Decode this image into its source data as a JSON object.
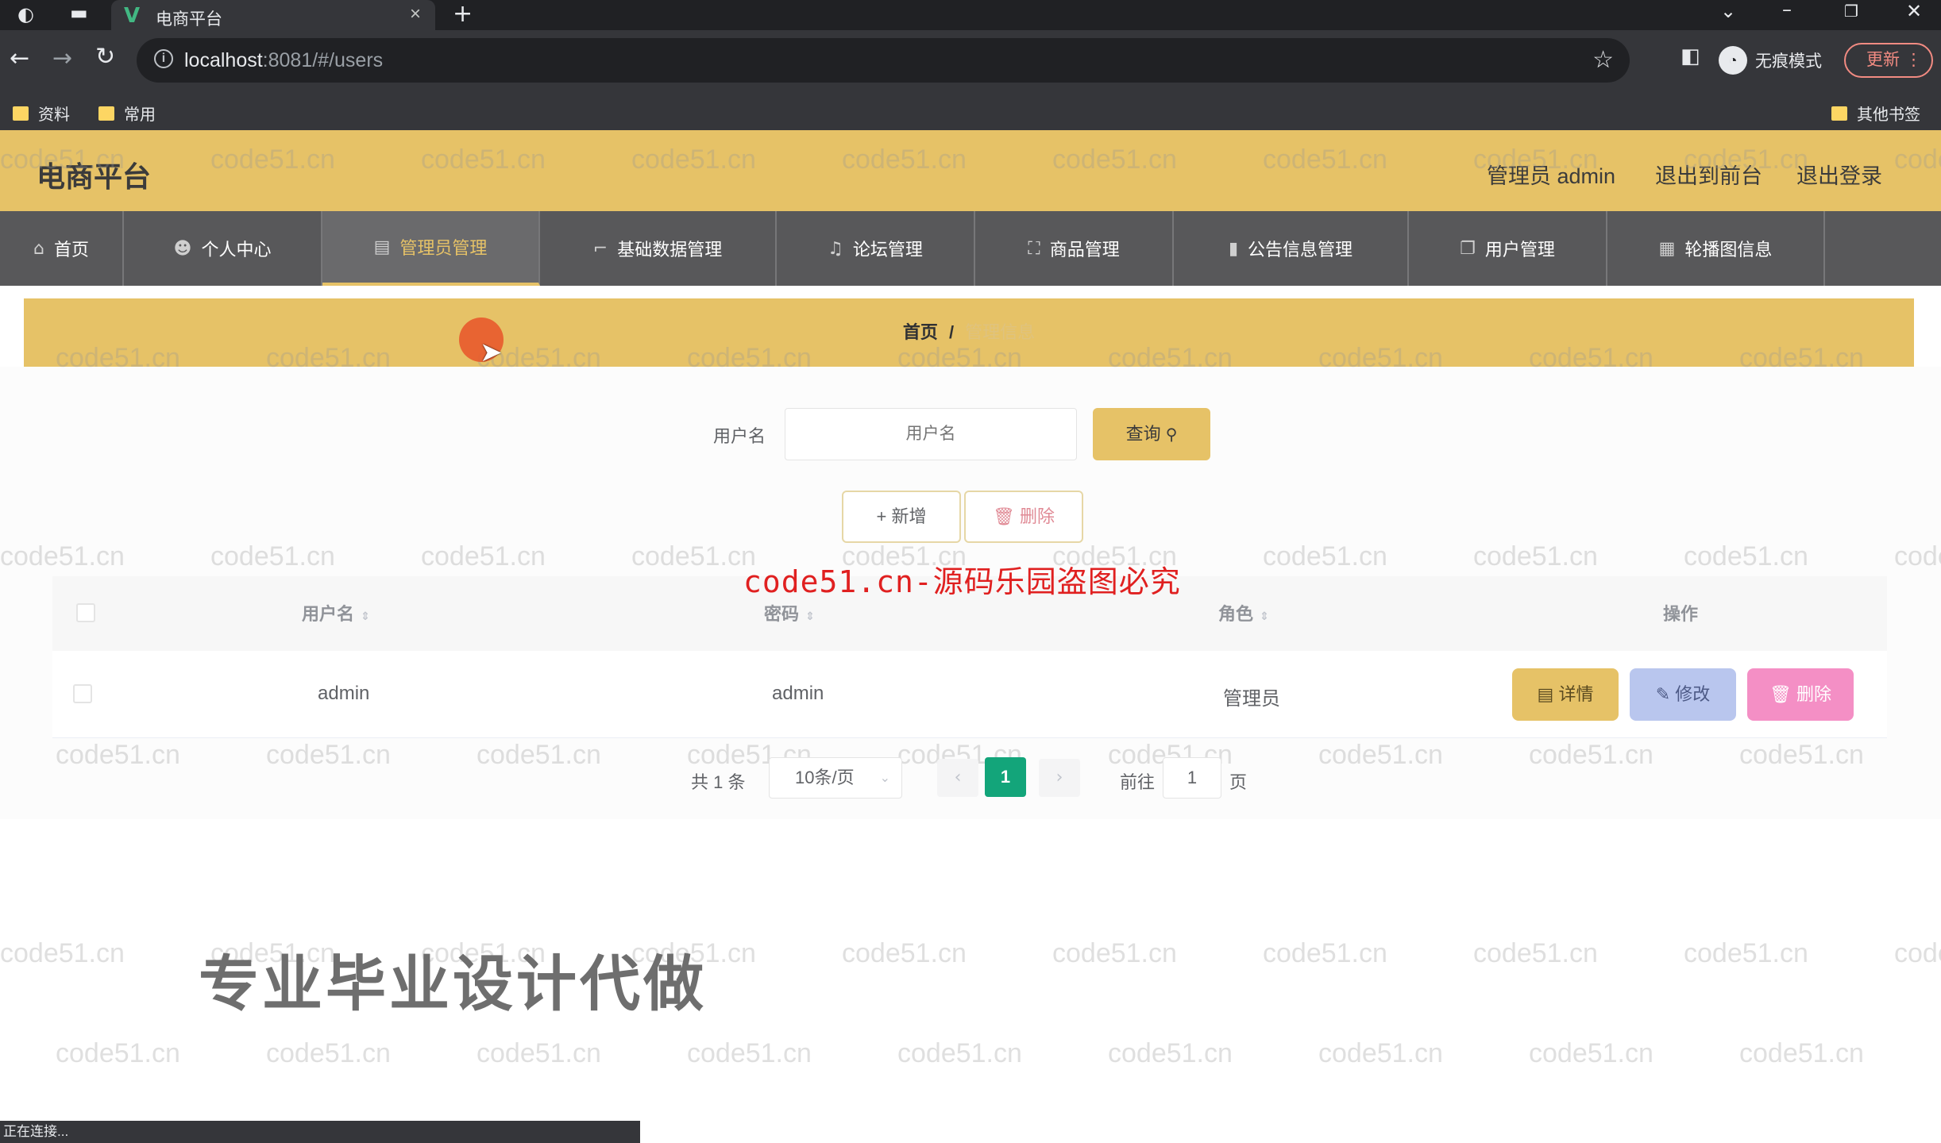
{
  "browser": {
    "tab_title": "电商平台",
    "tab_logo": "V",
    "url_host": "localhost",
    "url_rest": ":8081/#/users",
    "incognito_label": "无痕模式",
    "update_label": "更新",
    "bookmarks": [
      "资料",
      "常用"
    ],
    "other_bookmarks": "其他书签",
    "status_text": "正在连接..."
  },
  "header": {
    "title": "电商平台",
    "user_label": "管理员 admin",
    "to_front_label": "退出到前台",
    "logout_label": "退出登录"
  },
  "nav": {
    "items": [
      {
        "label": "首页",
        "icon": "home-icon"
      },
      {
        "label": "个人中心",
        "icon": "user-icon"
      },
      {
        "label": "管理员管理",
        "icon": "table-icon"
      },
      {
        "label": "基础数据管理",
        "icon": "crop-icon"
      },
      {
        "label": "论坛管理",
        "icon": "mic-icon"
      },
      {
        "label": "商品管理",
        "icon": "fullscreen-icon"
      },
      {
        "label": "公告信息管理",
        "icon": "notice-icon"
      },
      {
        "label": "用户管理",
        "icon": "copy-icon"
      },
      {
        "label": "轮播图信息",
        "icon": "grid-icon"
      }
    ]
  },
  "breadcrumb": {
    "home": "首页",
    "separator": "/",
    "current": "管理信息"
  },
  "search": {
    "label": "用户名",
    "placeholder": "用户名",
    "query_label": "查询"
  },
  "actions": {
    "add_label": "新增",
    "delete_label": "删除"
  },
  "table": {
    "headers": {
      "username": "用户名",
      "password": "密码",
      "role": "角色",
      "operation": "操作"
    },
    "rows": [
      {
        "username": "admin",
        "password": "admin",
        "role": "管理员"
      }
    ],
    "row_actions": {
      "detail": "详情",
      "edit": "修改",
      "delete": "删除"
    }
  },
  "pagination": {
    "total": "共 1 条",
    "page_size": "10条/页",
    "current_page": "1",
    "goto_label": "前往",
    "goto_value": "1",
    "page_unit": "页"
  },
  "overlay": {
    "red_watermark": "code51.cn-源码乐园盗图必究",
    "promo_text": "专业毕业设计代做",
    "watermark": "code51.cn"
  },
  "colors": {
    "accent": "#e6c267",
    "nav_bg": "#58585a",
    "page_active": "#13a57a"
  }
}
